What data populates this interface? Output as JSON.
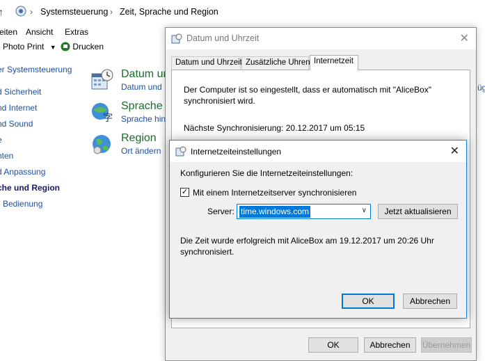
{
  "explorer": {
    "address": {
      "crumbs": [
        "Systemsteuerung",
        "Zeit, Sprache und Region"
      ],
      "separator": "›"
    },
    "menu": [
      "eiten",
      "Ansicht",
      "Extras"
    ],
    "toolbar": {
      "photo_print": "Photo Print",
      "print": "Drucken"
    },
    "nav": [
      "er Systemsteuerung",
      "d Sicherheit",
      "nd Internet",
      "nd Sound",
      "e",
      "nten",
      "d Anpassung",
      "che und Region",
      "Bedienung"
    ],
    "categories": [
      {
        "title": "Datum und",
        "sub": "Datum und"
      },
      {
        "title": "Sprache",
        "sub": "Sprache hinz"
      },
      {
        "title": "Region",
        "sub": "Ort ändern"
      }
    ],
    "right_edge_text": "üg"
  },
  "datetime_dialog": {
    "title": "Datum und Uhrzeit",
    "tabs": [
      "Datum und Uhrzeit",
      "Zusätzliche Uhren",
      "Internetzeit"
    ],
    "selected_tab": "Internetzeit",
    "sync_text": "Der Computer ist so eingestellt, dass er automatisch mit \"AliceBox\" synchronisiert wird.",
    "next_sync": "Nächste Synchronisierung: 20.12.2017 um 05:15",
    "buttons": {
      "ok": "OK",
      "cancel": "Abbrechen",
      "apply": "Übernehmen"
    }
  },
  "internet_time_dialog": {
    "title": "Internetzeiteinstellungen",
    "heading": "Konfigurieren Sie die Internetzeiteinstellungen:",
    "sync_checkbox_label": "Mit einem Internetzeitserver synchronisieren",
    "sync_checked": true,
    "server_label": "Server:",
    "server_value": "time.windows.com",
    "update_button": "Jetzt aktualisieren",
    "status_text": "Die Zeit wurde erfolgreich mit AliceBox am 19.12.2017 um 20:26 Uhr synchronisiert.",
    "ok": "OK",
    "cancel": "Abbrechen"
  },
  "colors": {
    "accent": "#0078d7",
    "link": "#1a50a8",
    "category_title": "#1e6a2e",
    "dialog_bg": "#f0f0f0"
  }
}
